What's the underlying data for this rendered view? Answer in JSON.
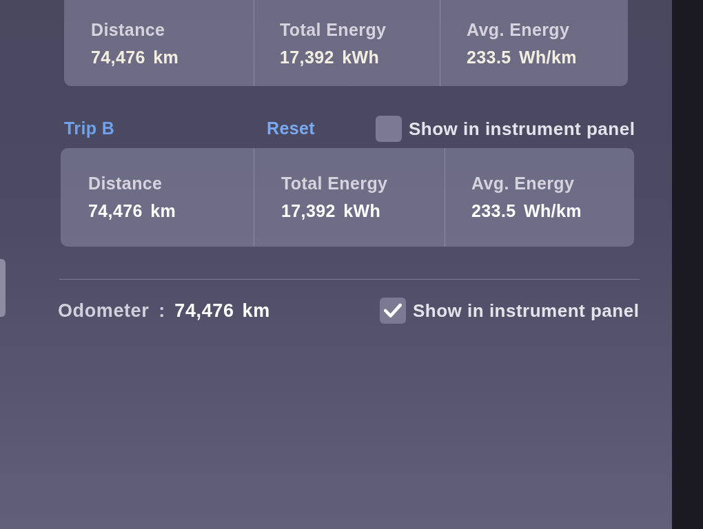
{
  "trip_a": {
    "stats": [
      {
        "label": "Distance",
        "value": "74,476 km"
      },
      {
        "label": "Total Energy",
        "value": "17,392 kWh"
      },
      {
        "label": "Avg. Energy",
        "value": "233.5 Wh/km"
      }
    ]
  },
  "trip_b": {
    "title": "Trip B",
    "reset": "Reset",
    "show_in_panel": {
      "label": "Show in instrument panel",
      "checked": false
    },
    "stats": [
      {
        "label": "Distance",
        "value": "74,476 km"
      },
      {
        "label": "Total Energy",
        "value": "17,392 kWh"
      },
      {
        "label": "Avg. Energy",
        "value": "233.5 Wh/km"
      }
    ]
  },
  "odometer": {
    "label": "Odometer",
    "separator": ":",
    "value": "74,476 km",
    "show_in_panel": {
      "label": "Show in instrument panel",
      "checked": true
    }
  }
}
